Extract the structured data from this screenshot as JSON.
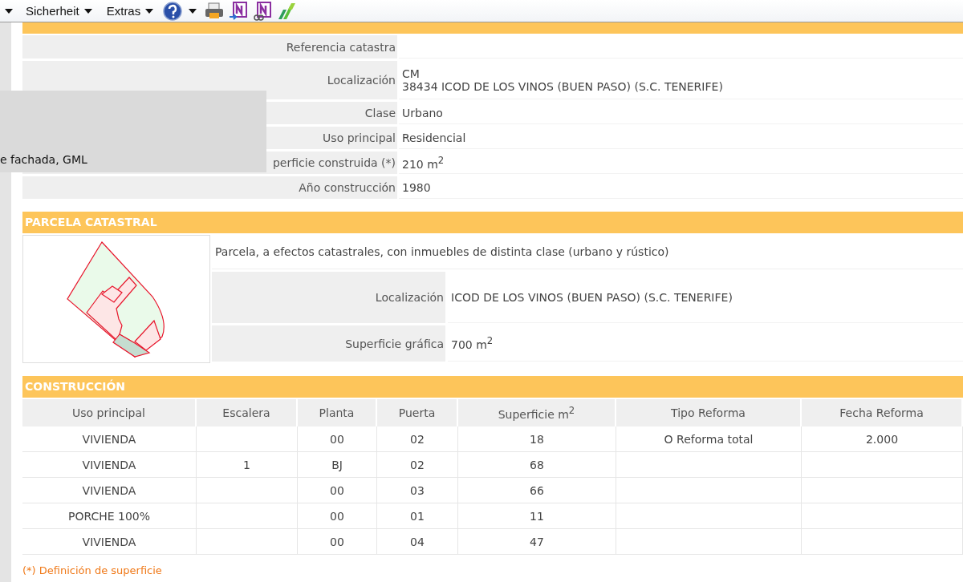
{
  "toolbar": {
    "menus": [
      {
        "label": "Sicherheit"
      },
      {
        "label": "Extras"
      }
    ]
  },
  "popup": {
    "text": "e fachada, GML"
  },
  "datos": {
    "rows": [
      {
        "label": "Referencia catastra",
        "lines": []
      },
      {
        "label": "Localización",
        "lines": [
          "CM",
          "38434 ICOD DE LOS VINOS (BUEN PASO) (S.C. TENERIFE)"
        ]
      },
      {
        "label": "Clase",
        "lines": [
          "Urbano"
        ]
      },
      {
        "label": "Uso principal",
        "lines": [
          "Residencial"
        ]
      },
      {
        "label": "perficie construida (*)",
        "lines": [
          "210 m$^{2}$"
        ]
      },
      {
        "label": "Año construcción",
        "lines": [
          "1980"
        ]
      }
    ]
  },
  "parcela": {
    "title": "PARCELA CATASTRAL",
    "description": "Parcela, a efectos catastrales, con inmuebles de distinta clase (urbano y rústico)",
    "rows": [
      {
        "label": "Localización",
        "value": "ICOD DE LOS VINOS (BUEN PASO) (S.C. TENERIFE)"
      },
      {
        "label": "Superficie gráfica",
        "value": "700 m$^{2}$"
      }
    ]
  },
  "construccion": {
    "title": "CONSTRUCCIÓN",
    "columns": [
      "Uso principal",
      "Escalera",
      "Planta",
      "Puerta",
      "Superficie m$^{2}$",
      "Tipo Reforma",
      "Fecha Reforma"
    ],
    "rows": [
      [
        "VIVIENDA",
        "",
        "00",
        "02",
        "18",
        "O Reforma total",
        "2.000"
      ],
      [
        "VIVIENDA",
        "1",
        "BJ",
        "02",
        "68",
        "",
        ""
      ],
      [
        "VIVIENDA",
        "",
        "00",
        "03",
        "66",
        "",
        ""
      ],
      [
        "PORCHE 100%",
        "",
        "00",
        "01",
        "11",
        "",
        ""
      ],
      [
        "VIVIENDA",
        "",
        "00",
        "04",
        "47",
        "",
        ""
      ]
    ]
  },
  "footnote": "(*) Definición de superficie"
}
